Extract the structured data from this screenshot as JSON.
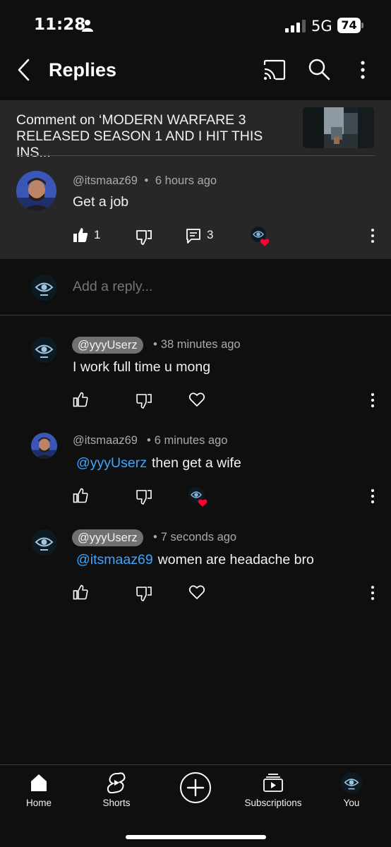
{
  "status_bar": {
    "time": "11:28",
    "network": "5G",
    "battery": "74"
  },
  "header": {
    "title": "Replies"
  },
  "context": {
    "text": "Comment on ‘MODERN WARFARE 3 RELEASED SEASON 1 AND I HIT THIS INS..."
  },
  "parent_comment": {
    "handle": "@itsmaaz69",
    "time": "6 hours ago",
    "text": "Get a job",
    "likes": "1",
    "replies": "3"
  },
  "add_reply": {
    "placeholder": "Add a reply..."
  },
  "replies": [
    {
      "handle": "@yyyUserz",
      "time": "38 minutes ago",
      "text": "I work full time u mong"
    },
    {
      "handle": "@itsmaaz69",
      "time": "6 minutes ago",
      "mention": "@yyyUserz",
      "text": "then get a wife"
    },
    {
      "handle": "@yyyUserz",
      "time": "7 seconds ago",
      "mention": "@itsmaaz69",
      "text": "women are headache bro"
    }
  ],
  "separator": "•",
  "nav": [
    {
      "label": "Home",
      "icon": "home-icon"
    },
    {
      "label": "Shorts",
      "icon": "shorts-icon"
    },
    {
      "label": "",
      "icon": "create-icon"
    },
    {
      "label": "Subscriptions",
      "icon": "subscriptions-icon"
    },
    {
      "label": "You",
      "icon": "you-avatar"
    }
  ],
  "colors": {
    "background": "#0f0f0f",
    "panel": "#272727",
    "mention": "#3ea6ff",
    "heart": "#ff0033"
  }
}
